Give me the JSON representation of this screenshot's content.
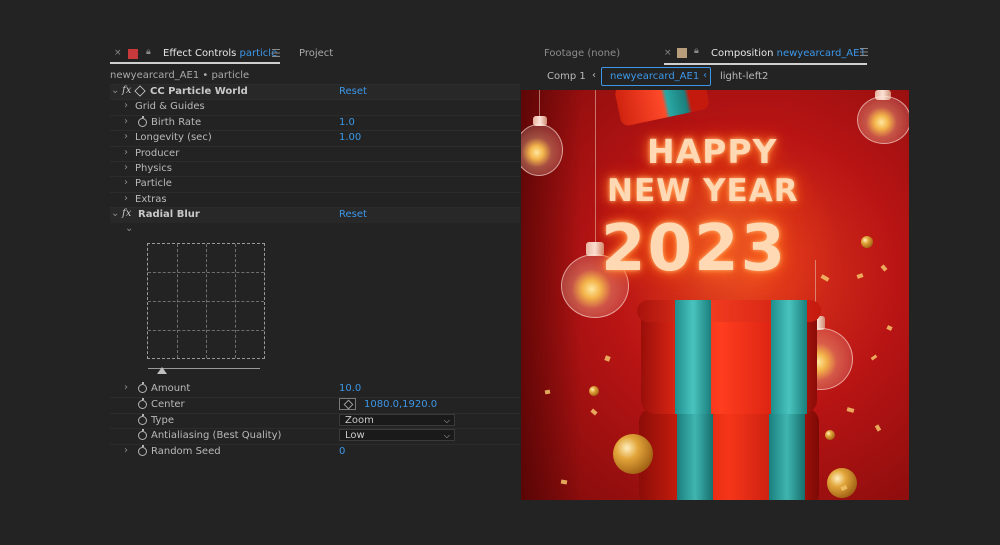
{
  "effect_panel": {
    "close_glyph": "×",
    "tab_prefix": "Effect Controls",
    "tab_layer": "particle",
    "menu_glyph": "☰",
    "project_tab": "Project",
    "breadcrumb": "newyearcard_AE1 • particle",
    "effects": [
      {
        "name": "CC Particle World",
        "reset": "Reset",
        "properties": [
          {
            "label": "Grid & Guides"
          },
          {
            "label": "Birth Rate",
            "value": "1.0"
          },
          {
            "label": "Longevity (sec)",
            "value": "1.00"
          },
          {
            "label": "Producer"
          },
          {
            "label": "Physics"
          },
          {
            "label": "Particle"
          },
          {
            "label": "Extras"
          }
        ]
      },
      {
        "name": "Radial Blur",
        "reset": "Reset",
        "properties": [
          {
            "label": "Amount",
            "value": "10.0"
          },
          {
            "label": "Center",
            "value": "1080.0,1920.0"
          },
          {
            "label": "Type",
            "value": "Zoom",
            "options_visible": [
              "Zoom"
            ]
          },
          {
            "label": "Antialiasing (Best Quality)",
            "value": "Low",
            "options_visible": [
              "Low"
            ]
          },
          {
            "label": "Random Seed",
            "value": "0"
          }
        ]
      }
    ]
  },
  "comp_panel": {
    "footage_tab": "Footage (none)",
    "tab_prefix": "Composition",
    "tab_comp": "newyearcard_AE1",
    "nav": {
      "comp1": "Comp 1",
      "active": "newyearcard_AE1",
      "next": "light-left2"
    },
    "viewer_text": {
      "line1": "HAPPY",
      "line2": "NEW YEAR",
      "line3": "2023"
    }
  },
  "colors": {
    "accent": "#3c97e8",
    "layer_label": "#c8393c",
    "comp_label": "#b79d7c",
    "panel_bg": "#232323"
  },
  "icons": [
    "close-icon",
    "lock-icon",
    "panel-menu-icon",
    "fx-icon",
    "cube-icon",
    "stopwatch-icon",
    "chevron-right-icon",
    "chevron-down-icon",
    "target-icon",
    "dropdown-arrow-icon"
  ]
}
